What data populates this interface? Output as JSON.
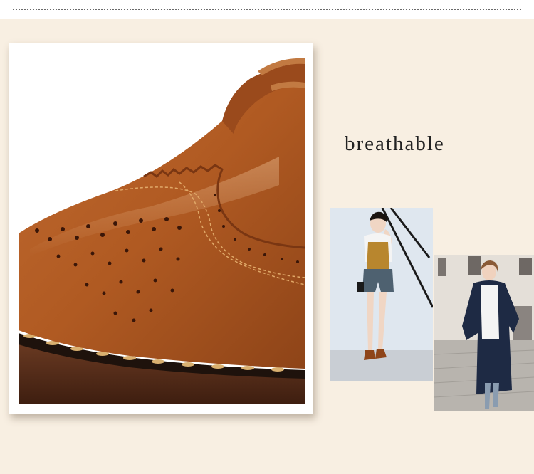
{
  "headline": "breathable",
  "colors": {
    "background": "#f8efe2",
    "leather": "#b8622a",
    "sole": "#5a2c18",
    "stitch": "#e0a868"
  },
  "images": {
    "shoe_closeup": "brogue-shoe-closeup-photo",
    "model_left": "model-in-yellow-top-and-denim-shorts-photo",
    "model_right": "model-in-navy-coat-photo"
  }
}
